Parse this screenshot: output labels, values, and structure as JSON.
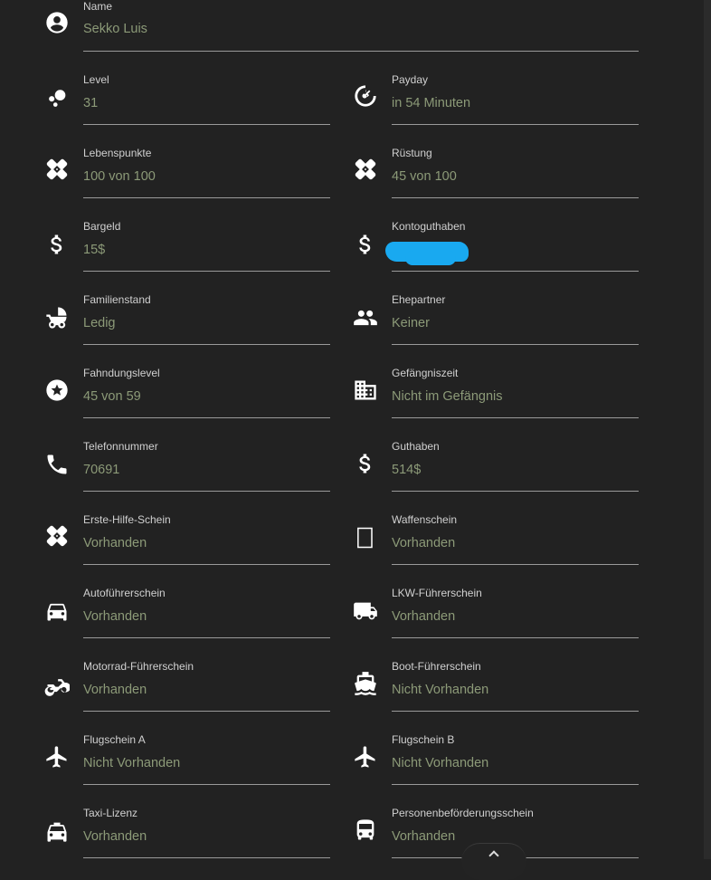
{
  "fields": {
    "name": {
      "label": "Name",
      "value": "Sekko Luis",
      "icon": "account-circle-icon"
    },
    "level": {
      "label": "Level",
      "value": "31",
      "icon": "bubbles-icon"
    },
    "payday": {
      "label": "Payday",
      "value": "in 54 Minuten",
      "icon": "timer-icon"
    },
    "lebenspunkte": {
      "label": "Lebenspunkte",
      "value": "100 von 100",
      "icon": "bandage-icon"
    },
    "ruestung": {
      "label": "Rüstung",
      "value": "45 von 100",
      "icon": "bandage-icon"
    },
    "bargeld": {
      "label": "Bargeld",
      "value": "15$",
      "icon": "dollar-icon"
    },
    "kontoguthaben": {
      "label": "Kontoguthaben",
      "value": "",
      "icon": "dollar-icon"
    },
    "familienstand": {
      "label": "Familienstand",
      "value": "Ledig",
      "icon": "baby-carriage-icon"
    },
    "ehepartner": {
      "label": "Ehepartner",
      "value": "Keiner",
      "icon": "people-icon"
    },
    "fahndungslevel": {
      "label": "Fahndungslevel",
      "value": "45 von 59",
      "icon": "star-circle-icon"
    },
    "gefaengniszeit": {
      "label": "Gefängniszeit",
      "value": "Nicht im Gefängnis",
      "icon": "building-icon"
    },
    "telefonnummer": {
      "label": "Telefonnummer",
      "value": "70691",
      "icon": "phone-icon"
    },
    "guthaben": {
      "label": "Guthaben",
      "value": "514$",
      "icon": "dollar-icon"
    },
    "erste_hilfe": {
      "label": "Erste-Hilfe-Schein",
      "value": "Vorhanden",
      "icon": "bandage-icon"
    },
    "waffenschein": {
      "label": "Waffenschein",
      "value": "Vorhanden",
      "icon": "missing-glyph-icon"
    },
    "autofuehrerschein": {
      "label": "Autoführerschein",
      "value": "Vorhanden",
      "icon": "car-icon"
    },
    "lkw": {
      "label": "LKW-Führerschein",
      "value": "Vorhanden",
      "icon": "truck-icon"
    },
    "motorrad": {
      "label": "Motorrad-Führerschein",
      "value": "Vorhanden",
      "icon": "motorcycle-icon"
    },
    "boot": {
      "label": "Boot-Führerschein",
      "value": "Nicht Vorhanden",
      "icon": "ship-icon"
    },
    "flug_a": {
      "label": "Flugschein A",
      "value": "Nicht Vorhanden",
      "icon": "airplane-icon"
    },
    "flug_b": {
      "label": "Flugschein B",
      "value": "Nicht Vorhanden",
      "icon": "airplane-icon"
    },
    "taxi": {
      "label": "Taxi-Lizenz",
      "value": "Vorhanden",
      "icon": "taxi-icon"
    },
    "personenbefoerderung": {
      "label": "Personenbeförderungsschein",
      "value": "Vorhanden",
      "icon": "bus-icon"
    }
  },
  "colors": {
    "background": "#222222",
    "label": "#d0d0d0",
    "value": "#8c9a78",
    "underline": "#9a9a9a",
    "icon": "#ffffff",
    "redaction": "#19a9f0"
  }
}
